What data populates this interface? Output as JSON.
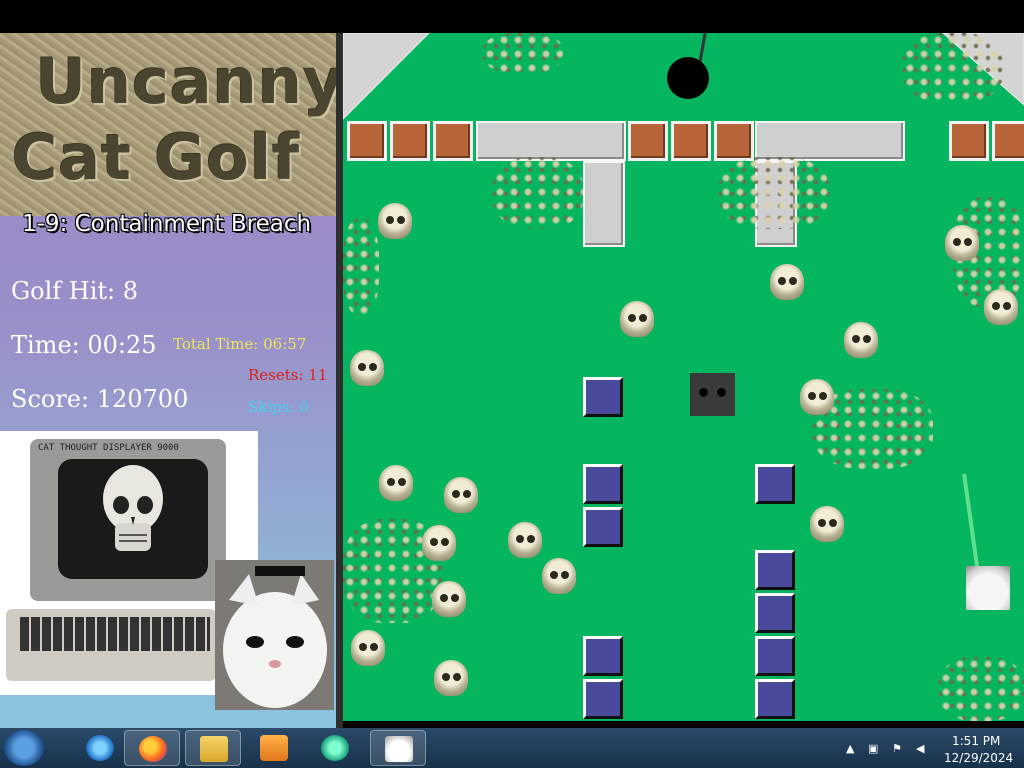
{
  "game": {
    "title_line1": "Uncanny",
    "title_line2": "Cat Golf",
    "level": "1-9: Containment Breach",
    "golf_hit": "Golf Hit: 8",
    "time": "Time: 00:25",
    "total_time": "Total Time: 06:57",
    "resets": "Resets: 11",
    "skips": "Skips: 0",
    "score": "Score: 120700",
    "monitor_caption": "CAT THOUGHT DISPLAYER 9000"
  },
  "colors": {
    "field": "#06b560",
    "total_time": "#f2e35a",
    "resets": "#e0201a",
    "skips": "#4dd0f0"
  },
  "taskbar": {
    "apps": [
      "start-orb",
      "internet-explorer-icon",
      "firefox-icon",
      "file-explorer-icon",
      "media-player-icon",
      "media-center-icon",
      "cat-golf-game-icon"
    ],
    "clock_time": "1:51 PM",
    "clock_date": "12/29/2024"
  }
}
